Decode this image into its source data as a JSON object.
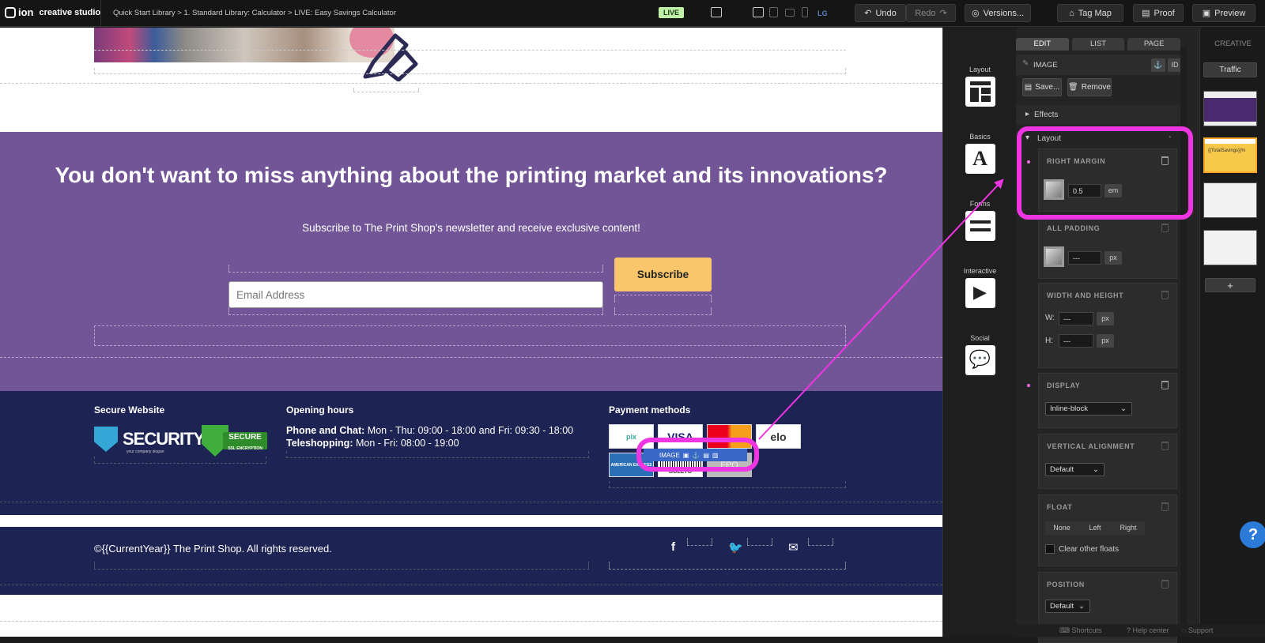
{
  "app": {
    "logo_text": "ion",
    "logo_sub": "creative studio"
  },
  "breadcrumb": "Quick Start Library > 1. Standard Library: Calculator > LIVE: Easy Savings Calculator",
  "status_badge": "LIVE",
  "device_size": "LG",
  "toolbar": {
    "undo": "Undo",
    "redo": "Redo",
    "versions": "Versions...",
    "tag_map": "Tag Map",
    "proof": "Proof",
    "preview": "Preview"
  },
  "promo": {
    "heading": "You don't want to miss anything about the printing market and its innovations?",
    "lead": "Subscribe to The Print Shop's newsletter and receive exclusive content!",
    "email_placeholder": "Email Address",
    "subscribe": "Subscribe"
  },
  "footer": {
    "col1_title": "Secure Website",
    "security_logo": "SECURITY",
    "security_slogan": "your company slogan",
    "secure_badge": "SECURE",
    "secure_badge_sub": "SSL ENCRYPTION",
    "col2_title": "Opening hours",
    "hours_line1_label": "Phone and Chat:",
    "hours_line1": " Mon - Thu: 09:00 - 18:00 and Fri: 09:30 - 18:00",
    "hours_line2_label": "Teleshopping:",
    "hours_line2": " Mon - Fri: 08:00 - 19:00",
    "col3_title": "Payment methods",
    "payments": [
      "pix",
      "VISA",
      "",
      "elo",
      "AMERICAN EXPRESS",
      "BOLETO",
      "FPO"
    ],
    "image_toolbar_label": "IMAGE",
    "copyright": "©{{CurrentYear}} The Print Shop. All rights reserved."
  },
  "left_panel": {
    "items": [
      {
        "label": "Layout",
        "icon": "layout-icon"
      },
      {
        "label": "Basics",
        "icon": "text-icon"
      },
      {
        "label": "Forms",
        "icon": "form-icon"
      },
      {
        "label": "Interactive",
        "icon": "play-icon"
      },
      {
        "label": "Social",
        "icon": "chat-icon"
      }
    ]
  },
  "right_panel": {
    "tabs": [
      "EDIT",
      "LIST",
      "PAGE"
    ],
    "element_type": "IMAGE",
    "id_btn": "ID",
    "save": "Save...",
    "remove": "Remove",
    "effects": "Effects",
    "layout": "Layout",
    "right_margin": {
      "title": "RIGHT MARGIN",
      "value": "0.5",
      "unit": "em"
    },
    "all_padding": {
      "title": "ALL PADDING",
      "value": "---",
      "unit": "px"
    },
    "width_height": {
      "title": "WIDTH AND HEIGHT",
      "w_label": "W:",
      "w_value": "---",
      "h_label": "H:",
      "h_value": "---",
      "unit": "px"
    },
    "display": {
      "title": "DISPLAY",
      "value": "Inline-block"
    },
    "vertical_alignment": {
      "title": "VERTICAL ALIGNMENT",
      "value": "Default"
    },
    "float": {
      "title": "FLOAT",
      "options": [
        "None",
        "Left",
        "Right"
      ],
      "clear": "Clear other floats"
    },
    "position": {
      "title": "POSITION",
      "value": "Default"
    }
  },
  "creative_panel": {
    "title": "CREATIVE",
    "traffic": "Traffic",
    "add": "+",
    "thumb_text": "{{TotalSavings}}%"
  },
  "bottom_bar": {
    "shortcuts": "Shortcuts",
    "help_center": "Help center",
    "support": "Support"
  },
  "help": "?",
  "colors": {
    "highlight": "#ef34e1",
    "promo_bg": "#725597",
    "footer_bg": "#1d2353",
    "subscribe_bg": "#f9c66b"
  }
}
